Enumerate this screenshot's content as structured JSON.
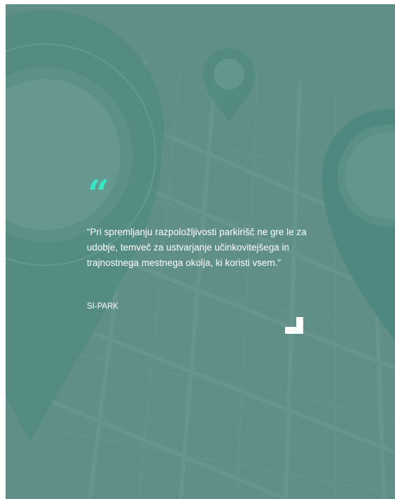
{
  "testimonial": {
    "quote_mark": "“",
    "quote": "“Pri spremljanju razpoložljivosti parkirišč ne gre le za udobje, temveč za ustvarjanje učinkovitejšega in trajnostnega mestnega okolja, ki koristi vsem.”",
    "author": "SI-PARK"
  },
  "icons": {
    "background": "map-pins-background",
    "corner": "corner-accent-icon"
  },
  "colors": {
    "background": "#5f8f86",
    "accent": "#33e6c4",
    "text": "#ffffff"
  }
}
